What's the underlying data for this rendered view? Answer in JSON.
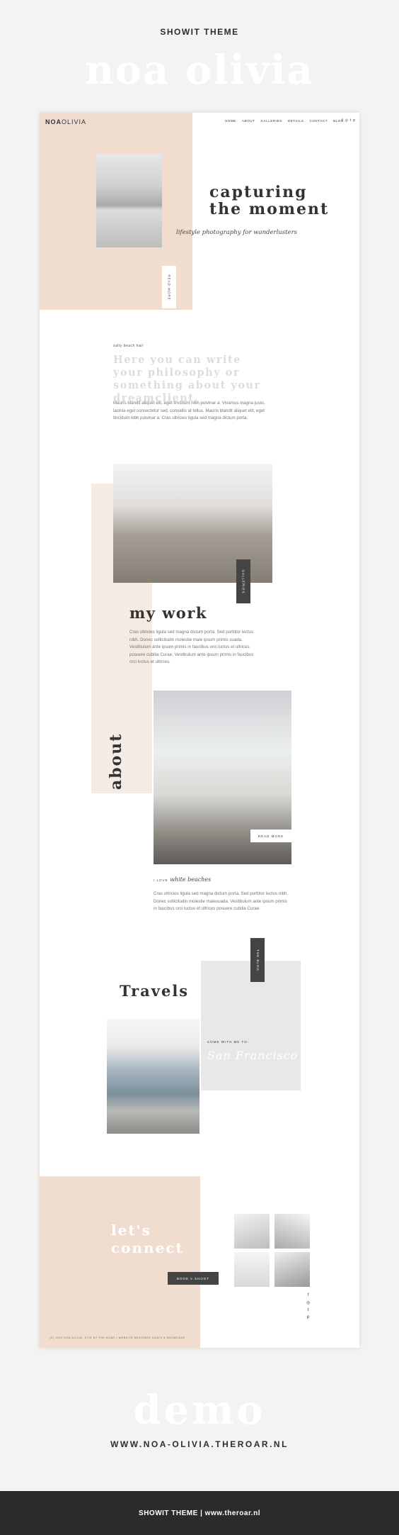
{
  "top_label": "SHOWIT THEME",
  "ghost_title": "noa olivia",
  "mock": {
    "logo_bold": "NOA",
    "logo_light": "OLIVIA",
    "nav": [
      "HOME",
      "ABOUT",
      "GALLERIES",
      "DETAILS",
      "CONTACT",
      "BLOG"
    ],
    "social_icons": [
      "facebook-icon",
      "instagram-icon",
      "twitter-icon",
      "pinterest-icon"
    ],
    "hero": {
      "title_line1": "capturing",
      "title_line2": "the moment",
      "subtitle": "lifestyle photography for wanderlusters",
      "vertical_button": "READ MORE"
    },
    "philosophy": {
      "label": "salty beach hair",
      "text": "Here you can write your philosophy or something about your dreamclient.",
      "paragraph": "Mauris blandit aliquet elit, eget tincidunt nibh pulvinar a. Vivamus magna justo, lacinia eget consectetur sed, convallis at tellus. Mauris blandit aliquet elit, eget tincidunt nibh pulvinar a. Cras ultricies ligula sed magna dictum porta."
    },
    "work": {
      "gallery_button": "GALLERIES",
      "title": "my work",
      "paragraph": "Cras ultricies ligula sed magna dictum porta. Sed porttitor lectus nibh. Donec sollicitudin molestie male ipsum primis suada. Vestibulum ante ipsum primis in faucibus orci luctus et ultrices posuere cubilia Curae; Vestibulum ante ipsum primis in faucibus orci luctus et ultrices."
    },
    "about": {
      "vertical_title": "about",
      "read_more": "READ MORE",
      "love_prefix": "I LOVE",
      "love_script": "white beaches",
      "paragraph": "Cras ultricies ligula sed magna dictum porta. Sed porttitor lectus nibh. Donec sollicitudin molestie malesuada. Vestibulum ante ipsum primis in faucibus orci luctus et ultrices posuere cubilia Curae."
    },
    "travels": {
      "blog_button": "THE BLOG",
      "title": "Travels",
      "come_with": "COME WITH ME TO:",
      "city": "San Francisco"
    },
    "connect": {
      "line1": "let's",
      "line2": "connect",
      "book_button": "BOOK A SHOOT",
      "side_social": [
        "f",
        "◎",
        "t",
        "p"
      ],
      "footer": "(C) 2019 NOA OLIVIA. SITE BY THE ROAR • WEBSITE DESIGNED SAVES & SHOWCASE"
    }
  },
  "ghost_demo": "demo",
  "demo_url": "WWW.NOA-OLIVIA.THEROAR.NL",
  "bottom_bar": "SHOWIT THEME | www.theroar.nl"
}
